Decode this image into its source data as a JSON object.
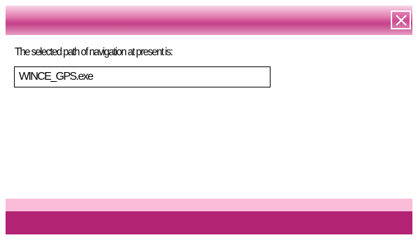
{
  "window": {
    "title": ""
  },
  "titlebar": {
    "close_icon": "close-icon",
    "gradient_top": "#f7d6e7",
    "gradient_mid": "#c6418a"
  },
  "content": {
    "prompt_label": "The selected path of navigation at present is:",
    "path_value": "WINCE_GPS.exe"
  },
  "colors": {
    "light_band": "#fbbcd9",
    "bottom_bar": "#b22373",
    "background": "#ffffff"
  }
}
